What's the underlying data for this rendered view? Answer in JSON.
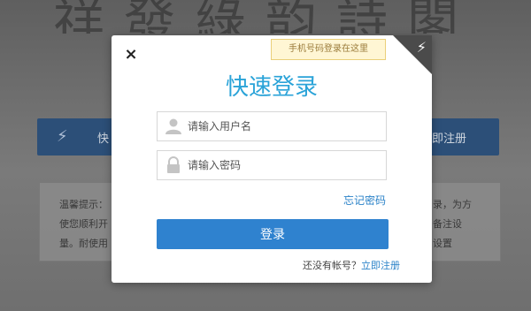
{
  "background": {
    "calligraphy": "祥發綠韵詩閣",
    "left_button_label": "快",
    "right_button_label": "即注册",
    "notice_left": [
      "温馨提示：",
      "使您顺利开",
      "量。耐使用"
    ],
    "notice_right": [
      "录，为方",
      "备注设",
      "设置"
    ]
  },
  "modal": {
    "close_symbol": "×",
    "tip": "手机号码登录在这里",
    "corner_symbol": "⚡",
    "title": "快速登录",
    "username_placeholder": "请输入用户名",
    "password_placeholder": "请输入密码",
    "forgot_label": "忘记密码",
    "login_label": "登录",
    "register_prompt": "还没有帐号？",
    "register_link": "立即注册"
  },
  "colors": {
    "accent": "#2aa3d8",
    "button": "#2f82cf",
    "link": "#2a82c8"
  }
}
